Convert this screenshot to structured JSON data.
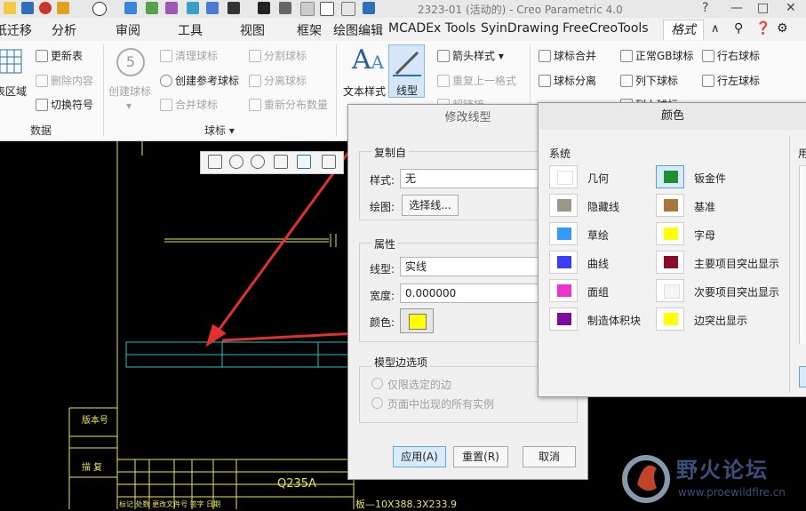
{
  "window": {
    "title": "2323-01 (活动的) - Creo Parametric 4.0",
    "controls": [
      "?",
      "—",
      "□",
      "✕"
    ]
  },
  "tabs": [
    {
      "label": "纸迁移"
    },
    {
      "label": "分析"
    },
    {
      "label": "审阅"
    },
    {
      "label": "工具"
    },
    {
      "label": "视图"
    },
    {
      "label": "框架"
    },
    {
      "label": "绘图编辑"
    },
    {
      "label": "MCADEx Tools"
    },
    {
      "label": "SyinDrawing"
    },
    {
      "label": "FreeCreoTools"
    },
    {
      "label": "格式"
    }
  ],
  "ribbon": {
    "data_group": {
      "label": "数据",
      "region": "表区域",
      "update_table": "更新表",
      "delete_content": "删除内容",
      "switch_symbol": "切换符号"
    },
    "balloon_group": {
      "label": "球标",
      "create_balloon": "创建球标",
      "clean_balloon": "清理球标",
      "create_ref_balloon": "创建参考球标",
      "merge_balloon": "合并球标",
      "split_balloon": "分割球标",
      "separate_balloon": "分离球标",
      "redistribute": "重新分布数量",
      "balloon_number": "5"
    },
    "format_group": {
      "text_style": "文本样式",
      "line_style": "线型",
      "arrow_style": "箭头样式",
      "repeat_last_format": "重复上一格式",
      "hyperlink": "超链接"
    },
    "custom_group": {
      "balloon_merge": "球标合并",
      "balloon_split": "球标分离",
      "gb_balloon": "正常GB球标",
      "row_right": "行右球标",
      "col_down": "列下球标",
      "row_left": "行左球标",
      "col_up": "列上球标"
    }
  },
  "canvas": {
    "labels": {
      "version": "版本号",
      "description": "描 复",
      "material": "Q235A",
      "plate_spec": "板—10X388.3X233.9",
      "table_header": "标记 处数 更改文件号 签字 日期"
    }
  },
  "modify_dialog": {
    "title": "修改线型",
    "copy_from": {
      "title": "复制自",
      "style_label": "样式:",
      "style_value": "无",
      "drawing_label": "绘图:",
      "select_line_button": "选择线..."
    },
    "attributes": {
      "title": "属性",
      "linetype_label": "线型:",
      "linetype_value": "实线",
      "width_label": "宽度:",
      "width_value": "0.000000",
      "color_label": "颜色:",
      "color_value": "#ffff00"
    },
    "model_edge": {
      "title": "模型边选项",
      "option1": "仅限选定的边",
      "option2": "页面中出现的所有实例"
    },
    "buttons": {
      "apply": "应用(A)",
      "reset": "重置(R)",
      "cancel": "取消"
    }
  },
  "color_dialog": {
    "title": "颜色",
    "system_label": "系统",
    "user_label": "用",
    "left_colors": [
      {
        "name": "几何",
        "color": "#ffffff"
      },
      {
        "name": "隐藏线",
        "color": "#9b9689"
      },
      {
        "name": "草绘",
        "color": "#3399ff"
      },
      {
        "name": "曲线",
        "color": "#3c3cff"
      },
      {
        "name": "面组",
        "color": "#ee33cc"
      },
      {
        "name": "制造体积块",
        "color": "#7a0aa3"
      }
    ],
    "right_colors": [
      {
        "name": "钣金件",
        "color": "#1f8f2f"
      },
      {
        "name": "基准",
        "color": "#a6783c"
      },
      {
        "name": "字母",
        "color": "#ffff00"
      },
      {
        "name": "主要项目突出显示",
        "color": "#8c0a2a"
      },
      {
        "name": "次要项目突出显示",
        "color": "#f5f5f5"
      },
      {
        "name": "边突出显示",
        "color": "#ffff00"
      }
    ]
  },
  "watermark": {
    "brand": "野火论坛",
    "url": "www.proewildfire.cn"
  }
}
